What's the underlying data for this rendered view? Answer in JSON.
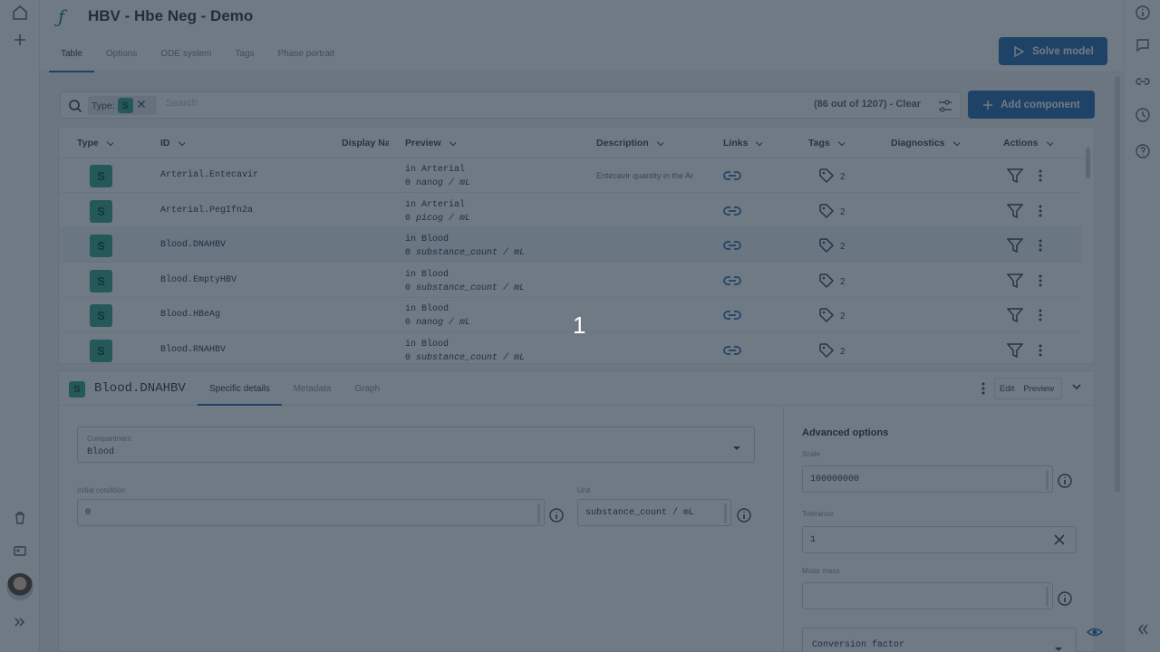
{
  "header": {
    "logo_glyph": "ƒ",
    "title": "HBV - Hbe Neg - Demo",
    "tabs": [
      {
        "label": "Table",
        "active": true
      },
      {
        "label": "Options",
        "active": false
      },
      {
        "label": "ODE system",
        "active": false
      },
      {
        "label": "Tags",
        "active": false
      },
      {
        "label": "Phase portrait",
        "active": false
      }
    ],
    "solve_label": "Solve model"
  },
  "search": {
    "chip_label": "Type:",
    "chip_value": "S",
    "placeholder": "Search",
    "result_count": "(86 out of 1207) - Clear",
    "add_label": "Add component"
  },
  "table": {
    "columns": [
      "Type",
      "ID",
      "Display Na",
      "Preview",
      "Description",
      "Links",
      "Tags",
      "Diagnostics",
      "Actions"
    ],
    "rows": [
      {
        "type": "S",
        "id": "Arterial.Entecavir",
        "preview_line1": "in Arterial",
        "preview_value": "0",
        "preview_unit": "nanog / mL",
        "description": "Entecavir quantity in the Ar",
        "tags": "2",
        "selected": false
      },
      {
        "type": "S",
        "id": "Arterial.PegIfn2a",
        "preview_line1": "in Arterial",
        "preview_value": "0",
        "preview_unit": "picog / mL",
        "description": "",
        "tags": "2",
        "selected": false
      },
      {
        "type": "S",
        "id": "Blood.DNAHBV",
        "preview_line1": "in Blood",
        "preview_value": "0",
        "preview_unit": "substance_count / mL",
        "description": "",
        "tags": "2",
        "selected": true
      },
      {
        "type": "S",
        "id": "Blood.EmptyHBV",
        "preview_line1": "in Blood",
        "preview_value": "0",
        "preview_unit": "substance_count / mL",
        "description": "",
        "tags": "2",
        "selected": false
      },
      {
        "type": "S",
        "id": "Blood.HBeAg",
        "preview_line1": "in Blood",
        "preview_value": "0",
        "preview_unit": "nanog / mL",
        "description": "",
        "tags": "2",
        "selected": false
      },
      {
        "type": "S",
        "id": "Blood.RNAHBV",
        "preview_line1": "in Blood",
        "preview_value": "0",
        "preview_unit": "substance_count / mL",
        "description": "",
        "tags": "2",
        "selected": false
      }
    ]
  },
  "overlay_number": "1",
  "detail": {
    "badge": "S",
    "title": "Blood.DNAHBV",
    "tabs": [
      {
        "label": "Specific details",
        "active": true
      },
      {
        "label": "Metadata",
        "active": false
      },
      {
        "label": "Graph",
        "active": false
      }
    ],
    "edit_label": "Edit",
    "preview_label": "Preview",
    "compartment_label": "Compartment",
    "compartment_value": "Blood",
    "initial_condition_label": "Initial condition",
    "initial_condition_value": "0",
    "unit_label": "Unit",
    "unit_value": "substance_count / mL",
    "advanced_title": "Advanced options",
    "scale_label": "Scale",
    "scale_value": "100000000",
    "tolerance_label": "Tolerance",
    "tolerance_value": "1",
    "molar_mass_label": "Molar mass",
    "molar_mass_value": "",
    "conversion_label": "Conversion factor"
  },
  "colors": {
    "accent": "#2a6fb3",
    "species_badge": "#3ba88f",
    "overlay": "#182838"
  }
}
